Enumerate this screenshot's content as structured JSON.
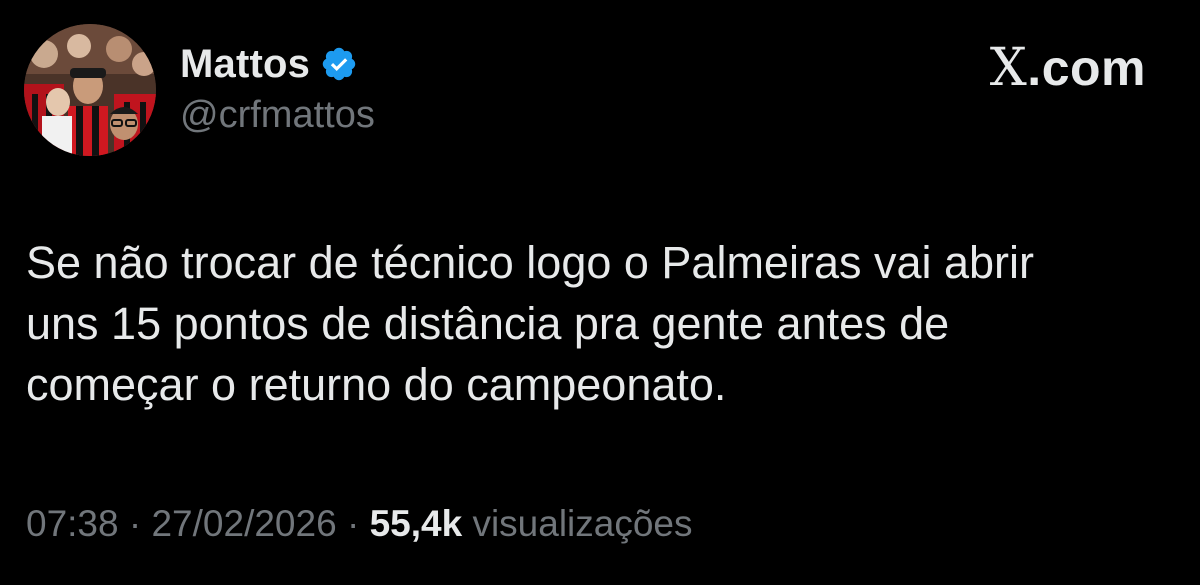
{
  "author": {
    "display_name": "Mattos",
    "handle": "@crfmattos",
    "verified_icon": "verified-badge-icon",
    "verified_color": "#1d9bf0"
  },
  "brand": {
    "x_letter": "X",
    "domain_suffix": ".com"
  },
  "tweet": {
    "text_lines": [
      "Se não trocar de técnico logo o Palmeiras vai abrir",
      "uns 15 pontos de distância pra gente antes de",
      "começar o returno do campeonato."
    ]
  },
  "meta": {
    "time": "07:38",
    "separator": "·",
    "date": "27/02/2026",
    "views_count": "55,4k",
    "views_label": "visualizações"
  },
  "colors": {
    "background": "#000000",
    "primary_text": "#e7e9ea",
    "secondary_text": "#71767b"
  }
}
